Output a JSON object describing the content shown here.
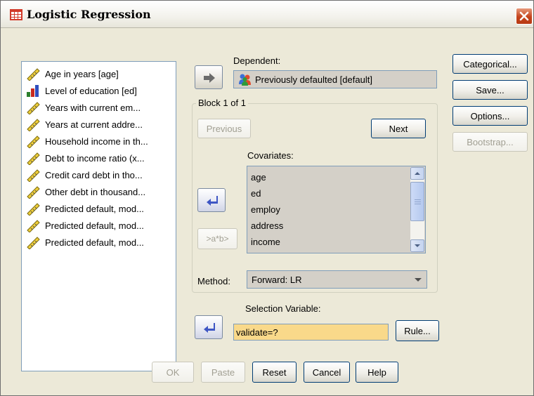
{
  "window": {
    "title": "Logistic Regression",
    "icon": "spss-table-icon",
    "close_icon": "close-icon"
  },
  "variables": [
    {
      "label": "Age in years [age]",
      "icon": "scale-ruler-icon"
    },
    {
      "label": "Level of education [ed]",
      "icon": "ordinal-bar-icon"
    },
    {
      "label": "Years with current em...",
      "icon": "scale-ruler-icon"
    },
    {
      "label": "Years at current addre...",
      "icon": "scale-ruler-icon"
    },
    {
      "label": "Household income in th...",
      "icon": "scale-ruler-icon"
    },
    {
      "label": "Debt to income ratio (x...",
      "icon": "scale-ruler-icon"
    },
    {
      "label": "Credit card debt in tho...",
      "icon": "scale-ruler-icon"
    },
    {
      "label": "Other debt in thousand...",
      "icon": "scale-ruler-icon"
    },
    {
      "label": "Predicted default, mod...",
      "icon": "scale-ruler-icon"
    },
    {
      "label": "Predicted default, mod...",
      "icon": "scale-ruler-icon"
    },
    {
      "label": "Predicted default, mod...",
      "icon": "scale-ruler-icon"
    }
  ],
  "dependent": {
    "label": "Dependent:",
    "value": "Previously defaulted [default]",
    "icon": "nominal-people-icon"
  },
  "block": {
    "title": "Block 1 of 1",
    "previous": "Previous",
    "next": "Next"
  },
  "covariates": {
    "label": "Covariates:",
    "items": [
      "age",
      "ed",
      "employ",
      "address",
      "income"
    ]
  },
  "interaction_button": ">a*b>",
  "method": {
    "label": "Method:",
    "value": "Forward: LR"
  },
  "selection": {
    "label": "Selection Variable:",
    "value": "validate=?",
    "rule_button": "Rule..."
  },
  "side_buttons": {
    "categorical": "Categorical...",
    "save": "Save...",
    "options": "Options...",
    "bootstrap": "Bootstrap..."
  },
  "bottom_buttons": {
    "ok": "OK",
    "paste": "Paste",
    "reset": "Reset",
    "cancel": "Cancel",
    "help": "Help"
  },
  "colors": {
    "dialog_bg": "#ece9d8",
    "selection_field_bg": "#f9d98a",
    "arrow_blue": "#3e56c4",
    "close_red": "#c4431b"
  }
}
